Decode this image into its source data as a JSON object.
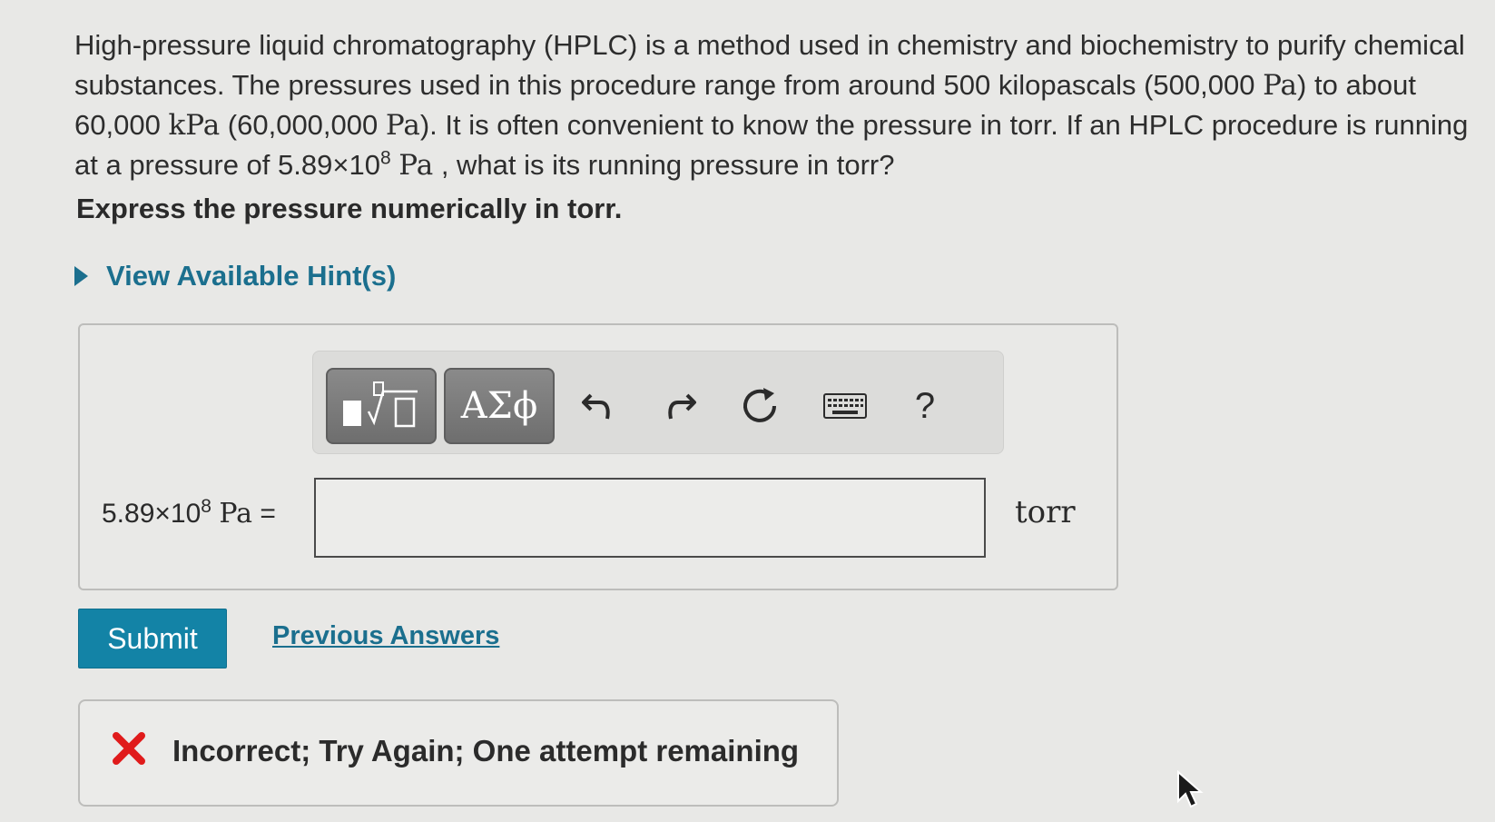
{
  "question": {
    "part1": "High-pressure liquid chromatography (HPLC) is a method used in chemistry and biochemistry to purify chemical substances. The pressures used in this procedure range from around 500 kilopascals (500,000 ",
    "unit_pa": "Pa",
    "part2": ") to about 60,000 ",
    "unit_kpa": "kPa",
    "part3": " (60,000,000 ",
    "part4": "). It is often convenient to know the pressure in torr. If an HPLC procedure is running at a pressure of 5.89×10",
    "exponent": "8",
    "part5": " , what is its running pressure in torr?"
  },
  "prompt": "Express the pressure numerically in torr.",
  "hints": {
    "label": "View Available Hint(s)"
  },
  "toolbar": {
    "greek_label": "ΑΣϕ",
    "help_label": "?",
    "icons": [
      "templates-icon",
      "greek-letters-icon",
      "undo-icon",
      "redo-icon",
      "reset-icon",
      "keyboard-icon",
      "help-icon"
    ]
  },
  "answer": {
    "lhs_mantissa": "5.89×10",
    "lhs_exponent": "8",
    "lhs_unit": "Pa",
    "equals": "=",
    "value": "",
    "placeholder": "",
    "unit": "torr"
  },
  "actions": {
    "submit_label": "Submit",
    "previous_answers_label": "Previous Answers"
  },
  "feedback": {
    "message": "Incorrect; Try Again; One attempt remaining",
    "status_color": "#e01b1b"
  },
  "colors": {
    "accent": "#1383a6",
    "link": "#1b6f8e",
    "background": "#e8e8e6"
  }
}
